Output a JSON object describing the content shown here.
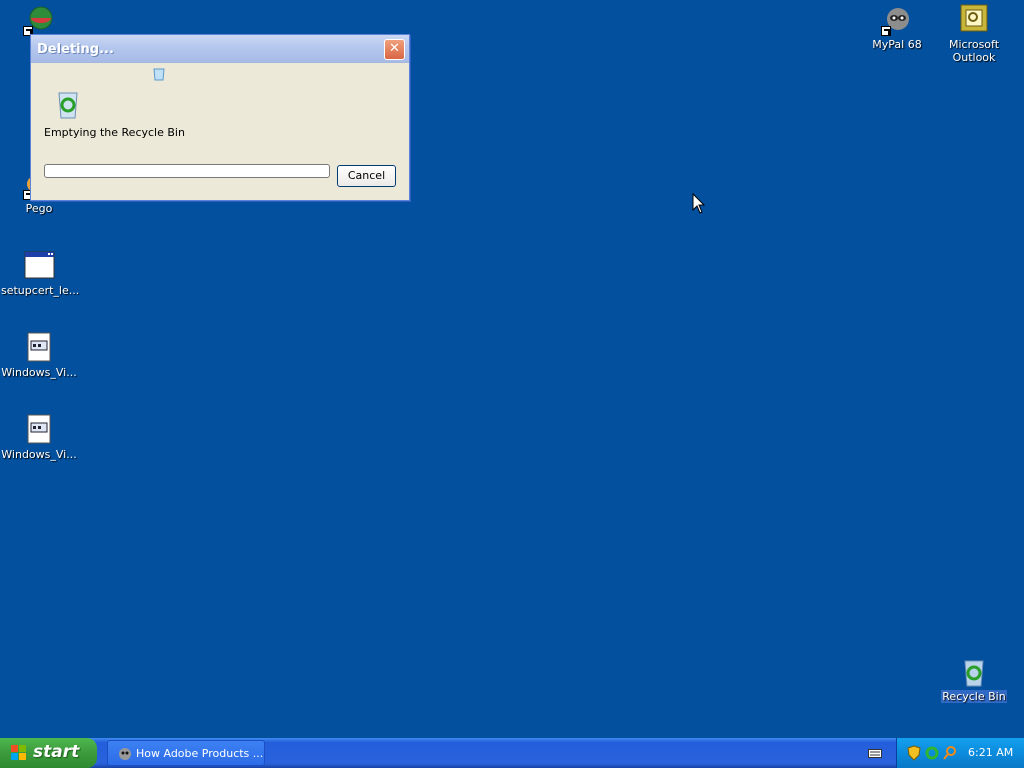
{
  "desktop": {
    "icons_left": [
      {
        "label": "",
        "icon": "network-sphere-icon"
      },
      {
        "label": "Pego",
        "icon": "pego-icon"
      },
      {
        "label": "setupcert_le...",
        "icon": "window-app-icon"
      },
      {
        "label": "Windows_Vi...",
        "icon": "document-icon"
      },
      {
        "label": "Windows_Vi...",
        "icon": "document-icon"
      }
    ],
    "icons_right": [
      {
        "label": "MyPal 68",
        "icon": "raccoon-icon"
      },
      {
        "label": "Microsoft\nOutlook",
        "label_line1": "Microsoft",
        "label_line2": "Outlook",
        "icon": "outlook-icon"
      }
    ],
    "recycle_bin": {
      "label": "Recycle Bin",
      "icon": "recycle-bin-icon"
    }
  },
  "dialog": {
    "title": "Deleting...",
    "message": "Emptying the Recycle Bin",
    "cancel_label": "Cancel",
    "progress_percent": 0
  },
  "taskbar": {
    "start_label": "start",
    "task_button_label": "How Adobe Products ...",
    "clock": "6:21 AM",
    "tray_icons": [
      "shield-icon",
      "recycle-sync-icon",
      "search-icon"
    ]
  },
  "colors": {
    "desktop": "#02509e",
    "taskbar": "#245edb",
    "start_button": "#3c9a3c",
    "tray": "#0c8bdc",
    "dialog_face": "#ece9d8"
  }
}
